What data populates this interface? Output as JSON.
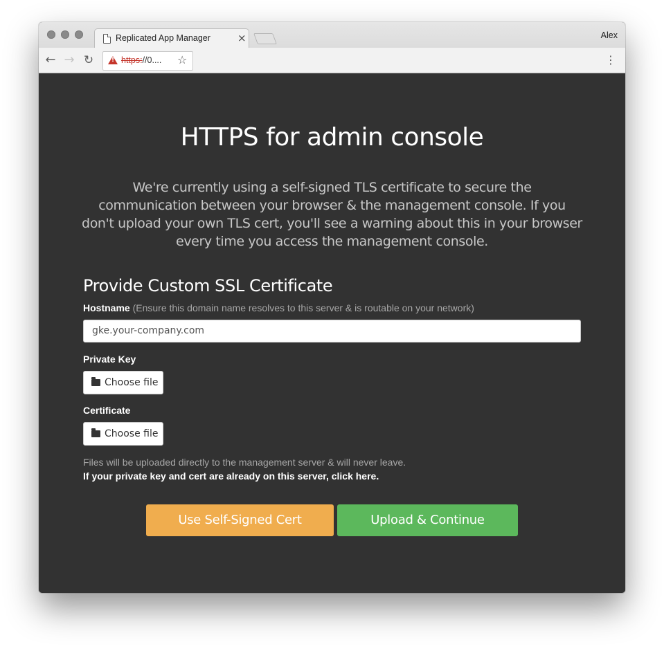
{
  "browser": {
    "tab_title": "Replicated App Manager",
    "tab_close": "×",
    "profile_name": "Alex",
    "url_scheme": "https:",
    "url_rest": "//0....",
    "icons": [
      "back-arrow-icon",
      "forward-arrow-icon",
      "reload-icon",
      "not-secure-warning-icon",
      "bookmark-star-icon",
      "menu-dots-icon"
    ]
  },
  "page": {
    "title": "HTTPS for admin console",
    "intro": "We're currently using a self-signed TLS certificate to secure the communication between your browser & the management console. If you don't upload your own TLS cert, you'll see a warning about this in your browser every time you access the management console.",
    "section_title": "Provide Custom SSL Certificate",
    "hostname": {
      "label": "Hostname",
      "hint": "(Ensure this domain name resolves to this server & is routable on your network)",
      "value": "gke.your-company.com"
    },
    "private_key": {
      "label": "Private Key",
      "button": "Choose file"
    },
    "certificate": {
      "label": "Certificate",
      "button": "Choose file"
    },
    "upload_note": "Files will be uploaded directly to the management server & will never leave.",
    "server_link": "If your private key and cert are already on this server, click here.",
    "buttons": {
      "self_signed": "Use Self-Signed Cert",
      "upload": "Upload & Continue"
    }
  },
  "colors": {
    "page_bg": "#323232",
    "self_signed_button": "#f0ad4e",
    "upload_button": "#5cb85c",
    "insecure_red": "#c5352b"
  }
}
